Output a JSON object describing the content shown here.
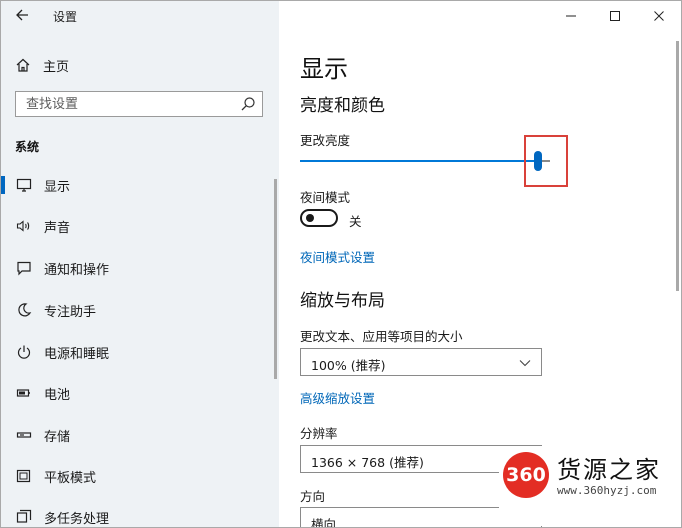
{
  "window": {
    "title": "设置"
  },
  "sidebar": {
    "home_label": "主页",
    "search_placeholder": "查找设置",
    "section_label": "系统",
    "items": [
      {
        "label": "显示",
        "icon": "monitor-icon",
        "active": true
      },
      {
        "label": "声音",
        "icon": "speaker-icon"
      },
      {
        "label": "通知和操作",
        "icon": "notification-icon"
      },
      {
        "label": "专注助手",
        "icon": "moon-icon"
      },
      {
        "label": "电源和睡眠",
        "icon": "power-icon"
      },
      {
        "label": "电池",
        "icon": "battery-icon"
      },
      {
        "label": "存储",
        "icon": "storage-icon"
      },
      {
        "label": "平板模式",
        "icon": "tablet-icon"
      },
      {
        "label": "多任务处理",
        "icon": "multitask-icon"
      }
    ]
  },
  "main": {
    "page_title": "显示",
    "brightness_heading": "亮度和颜色",
    "brightness_label": "更改亮度",
    "brightness_level": 0.95,
    "night_mode_label": "夜间模式",
    "night_mode_state": "关",
    "night_mode_link": "夜间模式设置",
    "layout_heading": "缩放与布局",
    "scale_label": "更改文本、应用等项目的大小",
    "scale_value": "100% (推荐)",
    "advanced_scale_link": "高级缩放设置",
    "resolution_label": "分辨率",
    "resolution_value": "1366 × 768 (推荐)",
    "orientation_label": "方向",
    "orientation_value": "横向"
  },
  "watermark": {
    "badge": "360",
    "name": "货源之家",
    "url": "www.360hyzj.com"
  },
  "colors": {
    "accent": "#0067c0",
    "highlight": "#d9413a",
    "sidebar_bg": "#eef2f5"
  }
}
